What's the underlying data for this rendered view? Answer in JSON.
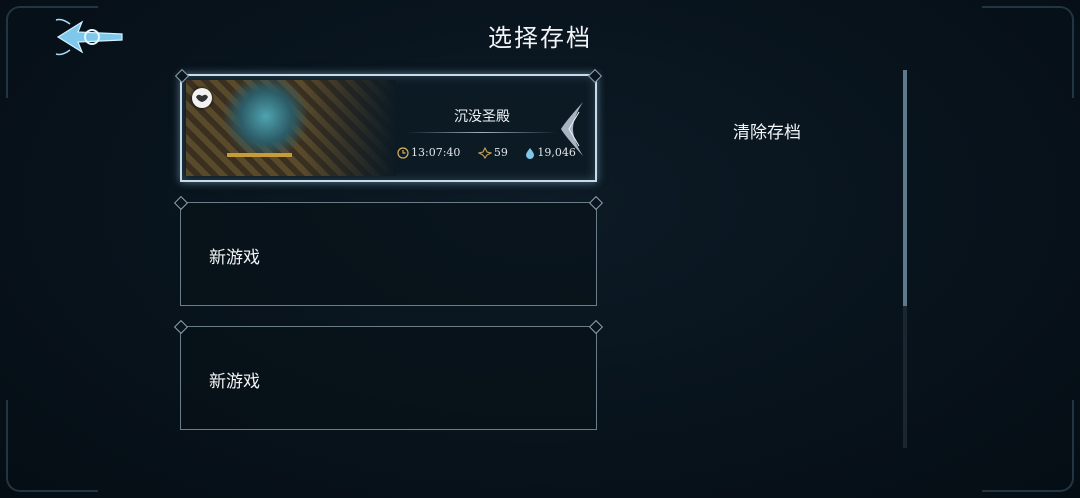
{
  "header": {
    "title": "选择存档"
  },
  "slots": [
    {
      "type": "save",
      "area_name": "沉没圣殿",
      "play_time": "13:07:40",
      "level": "59",
      "currency": "19,046"
    },
    {
      "type": "new",
      "label": "新游戏"
    },
    {
      "type": "new",
      "label": "新游戏"
    }
  ],
  "actions": {
    "clear_save": "清除存档"
  },
  "icons": {
    "back": "back-arrow-icon",
    "badge": "heart-emblem-icon",
    "time": "clock-icon",
    "level": "level-sigil-icon",
    "currency": "water-drop-icon"
  },
  "colors": {
    "accent": "#c79a3a",
    "frame": "#c9dbe6",
    "background": "#08131c"
  }
}
